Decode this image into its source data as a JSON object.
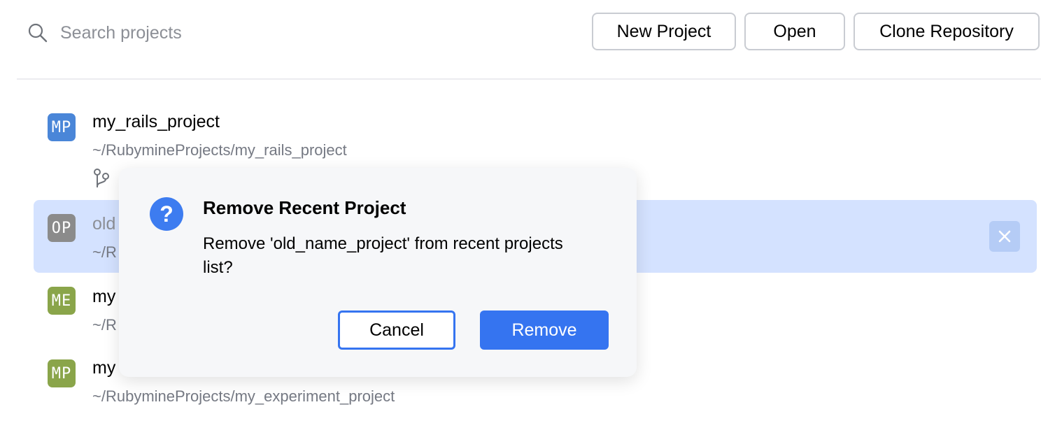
{
  "search": {
    "placeholder": "Search projects"
  },
  "toolbar": {
    "new_project_label": "New Project",
    "open_label": "Open",
    "clone_label": "Clone Repository"
  },
  "projects": [
    {
      "initials": "MP",
      "name": "my_rails_project",
      "path": "~/RubymineProjects/my_rails_project",
      "color": "#4a86d8",
      "has_branch_icon": true
    },
    {
      "initials": "OP",
      "name": "old_name_project",
      "name_visible": "old",
      "path_visible": "~/R",
      "color": "#8b8b8b",
      "selected": true
    },
    {
      "initials": "ME",
      "name_visible": "my",
      "path_visible": "~/R",
      "color": "#8aa54a"
    },
    {
      "initials": "MP",
      "name_visible": "my",
      "path": "~/RubymineProjects/my_experiment_project",
      "color": "#8aa54a"
    }
  ],
  "dialog": {
    "title": "Remove Recent Project",
    "message": "Remove 'old_name_project' from recent projects list?",
    "cancel_label": "Cancel",
    "confirm_label": "Remove",
    "icon": "question-icon"
  },
  "colors": {
    "accent": "#3574f0",
    "selection": "#d4e2ff"
  }
}
